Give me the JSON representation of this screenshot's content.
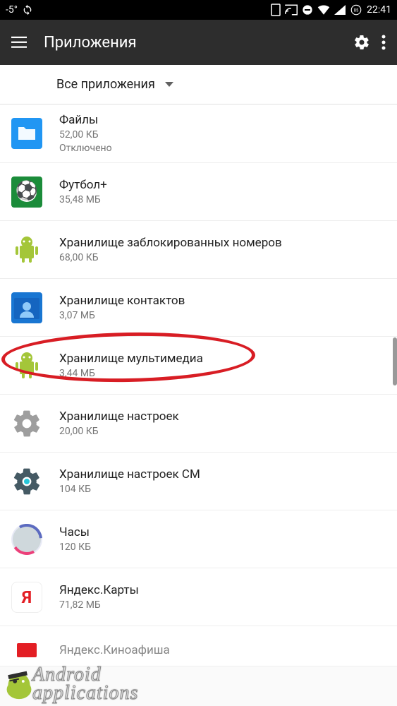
{
  "status_bar": {
    "temp": "-5°",
    "refresh_icon": "refresh",
    "time": "22:41",
    "battery_pct": "85"
  },
  "app_bar": {
    "title": "Приложения"
  },
  "filter": {
    "label": "Все приложения"
  },
  "apps": [
    {
      "name": "Файлы",
      "size": "52,00 КБ",
      "status": "Отключено",
      "icon": "files"
    },
    {
      "name": "Футбол+",
      "size": "35,48 МБ",
      "status": "",
      "icon": "football"
    },
    {
      "name": "Хранилище заблокированных номеров",
      "size": "68,00 КБ",
      "status": "",
      "icon": "android"
    },
    {
      "name": "Хранилище контактов",
      "size": "3,07 МБ",
      "status": "",
      "icon": "contacts"
    },
    {
      "name": "Хранилище мультимедиа",
      "size": "3,44 МБ",
      "status": "",
      "icon": "android",
      "highlight": true
    },
    {
      "name": "Хранилище настроек",
      "size": "20,00 КБ",
      "status": "",
      "icon": "gear"
    },
    {
      "name": "Хранилище настроек CM",
      "size": "104 КБ",
      "status": "",
      "icon": "gear-dark"
    },
    {
      "name": "Часы",
      "size": "120 КБ",
      "status": "",
      "icon": "clock"
    },
    {
      "name": "Яндекс.Карты",
      "size": "71,82 МБ",
      "status": "",
      "icon": "yandex"
    },
    {
      "name": "Яндекс.Киноафиша",
      "size": "",
      "status": "",
      "icon": "kino"
    }
  ],
  "watermark": {
    "line1": "Android",
    "line2": "applications"
  }
}
